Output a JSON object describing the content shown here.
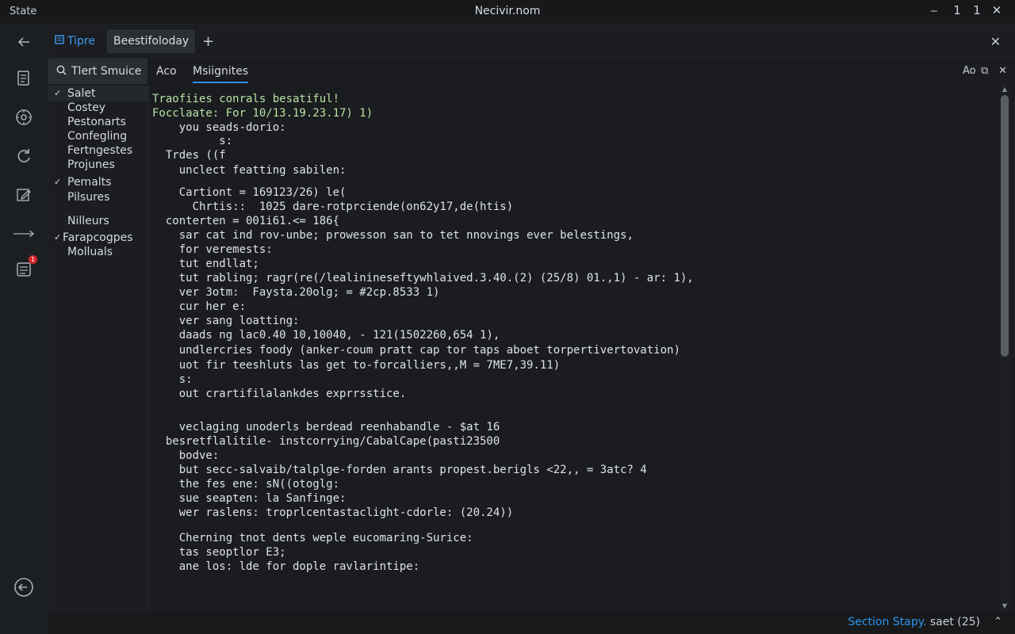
{
  "window": {
    "app_label": "State",
    "title": "Necivir.nom",
    "controls": [
      "⎯",
      "1",
      "1",
      "✕"
    ]
  },
  "tabs": {
    "tips_label": "Tipre",
    "active_tab": "Beestifoloday",
    "add": "+",
    "close": "✕"
  },
  "subbar": {
    "search_placeholder": "Tlert Smuice",
    "subtabs": [
      "Aco",
      "Msiignites"
    ],
    "right_controls": [
      "Ao",
      "⧉",
      "✕"
    ]
  },
  "sidebar": {
    "items": [
      {
        "label": "Salet",
        "checked": true
      },
      {
        "label": "Costey",
        "checked": false
      },
      {
        "label": "Pestonarts",
        "checked": false
      },
      {
        "label": "Confegling",
        "checked": false
      },
      {
        "label": "Fertngestes",
        "checked": false
      },
      {
        "label": "Projunes",
        "checked": false
      },
      {
        "label": "Pemalts",
        "checked": true
      },
      {
        "label": "Pilsures",
        "checked": false
      },
      {
        "label": "Nilleurs",
        "checked": false
      },
      {
        "label": "Farapcogpes",
        "checked": true
      },
      {
        "label": "Molluals",
        "checked": false
      }
    ]
  },
  "activity": {
    "icons": [
      "back-arrow-icon",
      "document-icon",
      "settings-icon",
      "refresh-icon",
      "edit-icon",
      "long-arrow-icon",
      "notes-icon"
    ],
    "badge": "1",
    "bottom_icon": "logout-icon"
  },
  "code": {
    "lines": [
      "Traofiies conrals besatiful!",
      "Focclaate: For 10/13.19.23.17) 1)",
      "    you seads-dorio:",
      "          s:",
      "  Trdes ((f",
      "    unclect featting sabilen:",
      "",
      "    Cartiont = 169123/26) le(",
      "      Chrtis::  1025 dare-rotprciende(on62y17,de(htis)",
      "  conterten = 001i61.<= 186{",
      "    sar cat ind rov-unbe; prowesson san to tet nnovings ever belestings,",
      "    for veremests:",
      "    tut endllat;",
      "    tut rabling; ragr(re(/lealinineseftywhlaived.3.40.(2) (25/8) 01.,1) - ar: 1),",
      "    ver 3otm:  Faysta.20olg; = #2cp.8533 1)",
      "    cur her e:",
      "    ver sang loatting:",
      "    daads ng lac0.40 10,10040, - 121(1502260,654 1),",
      "    undlercries foody (anker-coum pratt cap tor taps aboet torpertivertovation)",
      "    uot fir teeshluts las get to-forcalliers,,M = 7ME7,39.11)",
      "    s:",
      "    out crartifilalankdes exprrsstice.",
      "",
      "    veclaging unoderls berdead reenhabandle - $at 16",
      "  besretflalitile- instcorrying/CabalCape(pasti23500",
      "    bodve:",
      "    but secc-salvaib/talplge-forden arants propest.berigls <22,, = 3atc? 4",
      "    the fes ene: sN((otoglg:",
      "    sue seapten: la Sanfinge:",
      "    wer raslens: troprlcentastaclight-cdorle: (20.24))",
      "",
      "    Cherning tnot dents weple eucomaring-Surice:",
      "    tas seoptlor E3;",
      "    ane los: lde for dople ravlarintipe:"
    ]
  },
  "status": {
    "label": "Section Stapy.",
    "value": "saet (25)",
    "chevron": "⌃"
  }
}
